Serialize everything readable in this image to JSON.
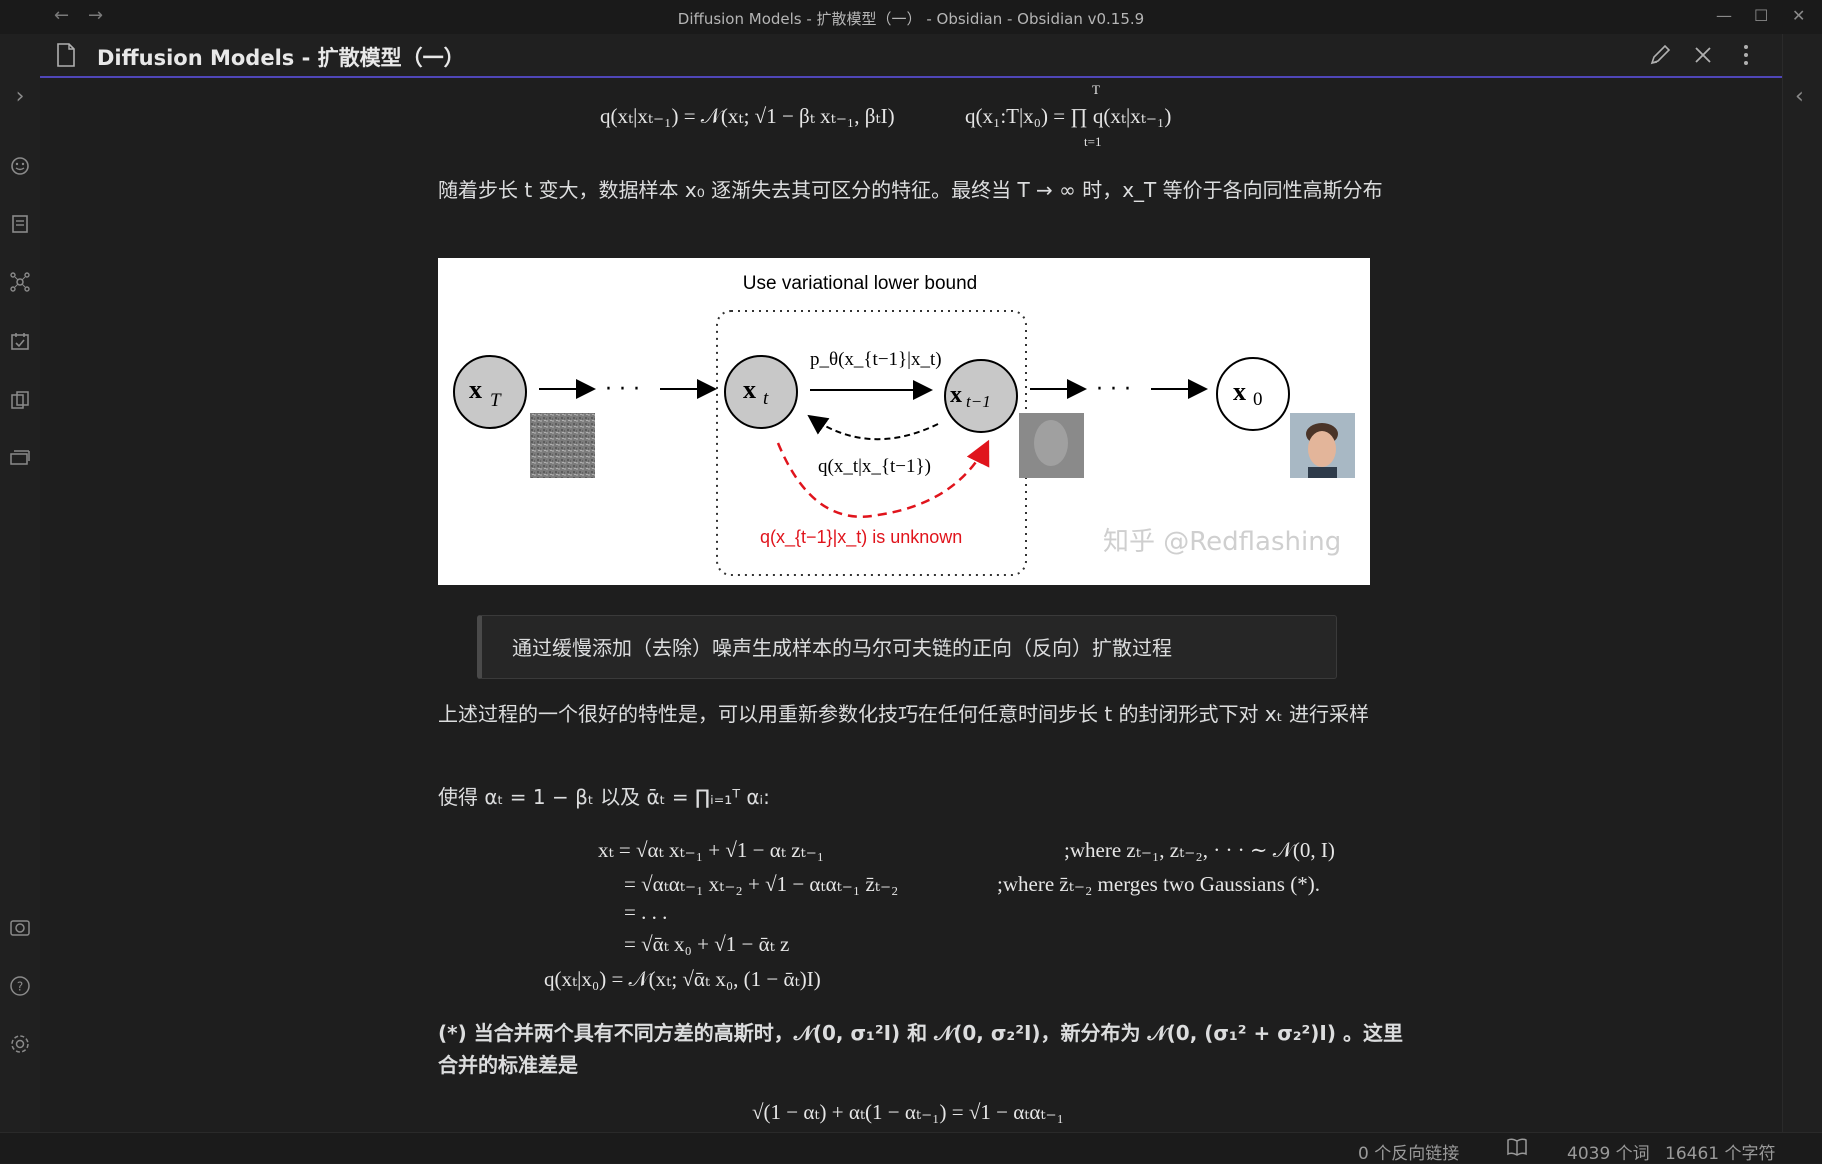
{
  "window": {
    "title": "Diffusion Models - 扩散模型（一） - Obsidian - Obsidian v0.15.9",
    "back_label": "←",
    "forward_label": "→",
    "minimize_label": "—",
    "maximize_label": "☐",
    "close_label": "✕"
  },
  "ribbon": {
    "expand_label": "›",
    "icons": [
      "switcher-icon",
      "file-explorer-icon",
      "graph-view-icon",
      "daily-note-icon",
      "templates-icon",
      "slides-icon",
      "vault-icon",
      "help-icon",
      "settings-icon"
    ]
  },
  "right_strip": {
    "collapse_label": "‹"
  },
  "tab": {
    "title": "Diffusion Models - 扩散模型（一）",
    "icons": [
      "edit-icon",
      "close-icon",
      "more-options-icon"
    ]
  },
  "content": {
    "formula_top_left": "q(xₜ|xₜ₋₁) = 𝒩(xₜ; √1 − βₜ xₜ₋₁, βₜI)",
    "formula_top_right": "q(x₁:T|x₀) = ∏ q(xₜ|xₜ₋₁)",
    "prod_upper": "T",
    "prod_lower": "t=1",
    "para1": "随着步长 t 变大，数据样本 x₀ 逐渐失去其可区分的特征。最终当 T → ∞ 时，x_T 等价于各向同性高斯分布",
    "figure": {
      "title": "Use variational lower bound",
      "node_xT": "x",
      "node_xT_sub": "T",
      "node_xt": "x",
      "node_xt_sub": "t",
      "node_xt1": "x",
      "node_xt1_sub": "t−1",
      "node_x0": "x",
      "node_x0_sub": "0",
      "dots": "· · ·",
      "p_label": "p_θ(x_{t−1}|x_t)",
      "q_label": "q(x_t|x_{t−1})",
      "unknown_label": "q(x_{t−1}|x_t) is unknown",
      "watermark": "知乎 @Redflashing"
    },
    "callout": "通过缓慢添加（去除）噪声生成样本的马尔可夫链的正向（反向）扩散过程",
    "para2": "上述过程的一个很好的特性是，可以用重新参数化技巧在任何任意时间步长 t 的封闭形式下对 xₜ 进行采样",
    "para3": "使得 αₜ = 1 − βₜ 以及 ᾱₜ = ∏ᵢ₌₁ᵀ αᵢ:",
    "eq_lines": [
      "xₜ = √αₜ xₜ₋₁ + √1 − αₜ zₜ₋₁",
      "= √αₜαₜ₋₁ xₜ₋₂ + √1 − αₜαₜ₋₁ z̄ₜ₋₂",
      "= . . .",
      "= √ᾱₜ x₀ + √1 − ᾱₜ z",
      "q(xₜ|x₀) = 𝒩(xₜ; √ᾱₜ x₀, (1 − ᾱₜ)I)"
    ],
    "eq_notes": [
      ";where zₜ₋₁, zₜ₋₂, · · · ∼ 𝒩(0, I)",
      ";where z̄ₜ₋₂ merges two Gaussians (*)."
    ],
    "para4": "(*) 当合并两个具有不同方差的高斯时，𝒩(0, σ₁²I) 和 𝒩(0, σ₂²I)，新分布为 𝒩(0, (σ₁² + σ₂²)I) 。这里合并的标准差是",
    "formula_bottom": "√(1 − αₜ) + αₜ(1 − αₜ₋₁) = √1 − αₜαₜ₋₁"
  },
  "statusbar": {
    "backlinks": "0 个反向链接",
    "words": "4039 个词",
    "chars": "16461 个字符"
  }
}
